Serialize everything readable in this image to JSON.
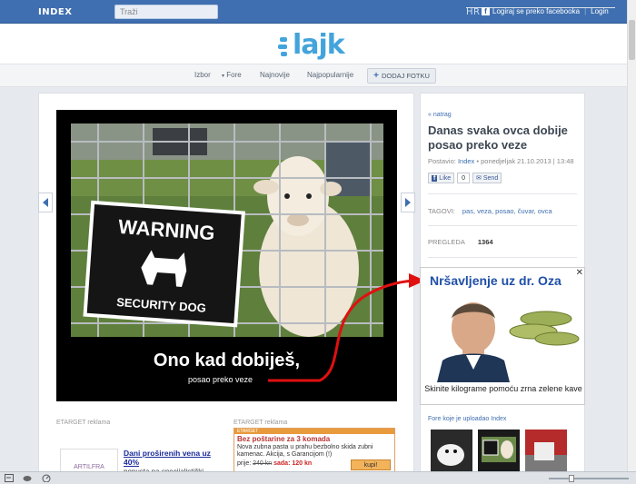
{
  "topbar": {
    "logo": "INDEX",
    "logo_suffix": "HR",
    "search_placeholder": "Traži",
    "fb_login": "Logiraj se preko facebooka",
    "login": "Login"
  },
  "brand": {
    "name": "lajk"
  },
  "nav": {
    "items": [
      "Izbor",
      "Fore",
      "Najnovije",
      "Najpopularnije"
    ],
    "add_photo": "DODAJ FOTKU"
  },
  "meme": {
    "caption_main": "Ono kad dobiješ,",
    "caption_sub": "posao preko veze",
    "sign_line1": "WARNING",
    "sign_line2": "SECURITY DOG"
  },
  "article": {
    "back": "« natrag",
    "title": "Danas svaka ovca dobije posao preko veze",
    "posted_label": "Postavio:",
    "author": "Index",
    "date": "• ponedjeljak 21.10.2013 | 13:48",
    "like_label": "Like",
    "like_count": "0",
    "send_label": "Send",
    "tags_label": "TAGOVI:",
    "tags": "pas, veza, posao, čuvar, ovca",
    "views_label": "PREGLEDA",
    "views": "1364"
  },
  "ads": {
    "label1": "ETARGET reklama",
    "label2": "ETARGET reklama",
    "ad1_title": "Dani proširenih vena uz 40%",
    "ad1_desc": "popusta na specijalistički",
    "ad1_logo": "ARTILFRA",
    "ad2_header": "ETARGET",
    "ad2_title": "Bez poštarine za 3 komada",
    "ad2_desc": "Nova zubna pasta u prahu bezbolno skida zubni kamenac. Akcija, s Garancijom (!)",
    "ad2_price_label": "prije:",
    "ad2_old_price": "240 kn",
    "ad2_new_label": "sada:",
    "ad2_new_price": "120 kn",
    "ad2_buy": "kupi!",
    "dr_title": "Nršavljenje uz dr. Oza",
    "dr_caption": "Skinite kilograme pomoću zrna zelene kave",
    "close": "✕"
  },
  "sidebar": {
    "fore_heading": "Fore koje je uploadao Index"
  }
}
